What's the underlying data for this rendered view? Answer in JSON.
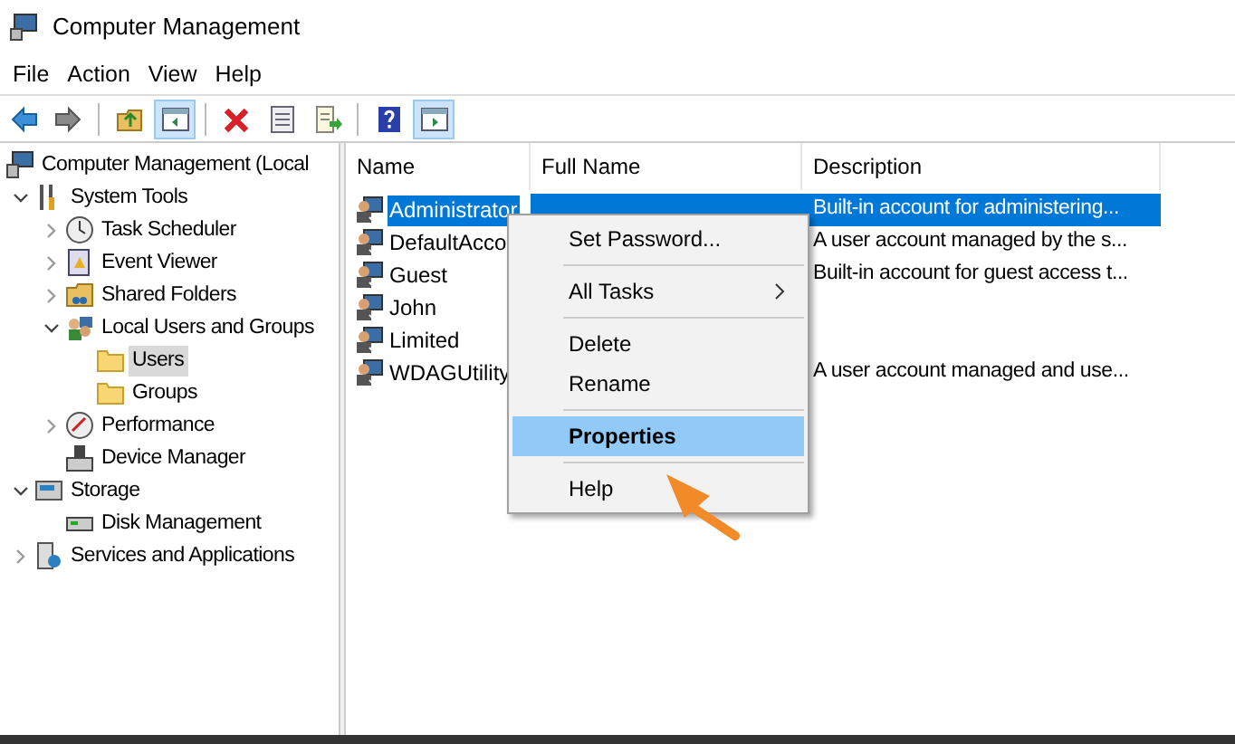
{
  "window": {
    "title": "Computer Management"
  },
  "menu": [
    "File",
    "Action",
    "View",
    "Help"
  ],
  "toolbar": {
    "groups": [
      [
        {
          "pressed": false
        },
        {
          "pressed": false
        }
      ],
      [
        {
          "pressed": false
        },
        {
          "pressed": true
        }
      ],
      [
        {
          "pressed": false
        },
        {
          "pressed": false
        },
        {
          "pressed": false
        }
      ],
      [
        {
          "pressed": false
        },
        {
          "pressed": true
        }
      ]
    ]
  },
  "tree": [
    {
      "label": "Computer Management (Local",
      "kind": "computer",
      "selected": false,
      "children": [
        {
          "label": "System Tools",
          "expandable": true,
          "expanded": true,
          "kind": "tools",
          "selected": false,
          "children": [
            {
              "label": "Task Scheduler",
              "expandable": true,
              "expanded": false,
              "kind": "clock",
              "selected": false
            },
            {
              "label": "Event Viewer",
              "expandable": true,
              "expanded": false,
              "kind": "log",
              "selected": false
            },
            {
              "label": "Shared Folders",
              "expandable": true,
              "expanded": false,
              "kind": "share",
              "selected": false
            },
            {
              "label": "Local Users and Groups",
              "expandable": true,
              "expanded": true,
              "kind": "users",
              "selected": false,
              "children": [
                {
                  "label": "Users",
                  "expandable": false,
                  "kind": "folder",
                  "selected": true
                },
                {
                  "label": "Groups",
                  "expandable": false,
                  "kind": "folder",
                  "selected": false
                }
              ]
            },
            {
              "label": "Performance",
              "expandable": true,
              "expanded": false,
              "kind": "gauge",
              "selected": false
            },
            {
              "label": "Device Manager",
              "expandable": false,
              "kind": "device",
              "selected": false
            }
          ]
        },
        {
          "label": "Storage",
          "expandable": true,
          "expanded": true,
          "kind": "storage",
          "selected": false,
          "children": [
            {
              "label": "Disk Management",
              "expandable": false,
              "kind": "disk",
              "selected": false
            }
          ]
        },
        {
          "label": "Services and Applications",
          "expandable": true,
          "expanded": false,
          "kind": "services",
          "selected": false
        }
      ]
    }
  ],
  "table": {
    "columns": [
      "Name",
      "Full Name",
      "Description"
    ],
    "rows": [
      {
        "name": "Administrator",
        "full_name": "",
        "description": "Built-in account for administering...",
        "selected": true
      },
      {
        "name": "DefaultAcco",
        "full_name": "",
        "description": "A user account managed by the s...",
        "selected": false
      },
      {
        "name": "Guest",
        "full_name": "",
        "description": "Built-in account for guest access t...",
        "selected": false
      },
      {
        "name": "John",
        "full_name": "",
        "description": "",
        "selected": false
      },
      {
        "name": "Limited",
        "full_name": "",
        "description": "",
        "selected": false
      },
      {
        "name": "WDAGUtility",
        "full_name": "",
        "description": "A user account managed and use...",
        "selected": false
      }
    ]
  },
  "context_menu": [
    {
      "label": "Set Password...",
      "submenu": false,
      "separator_after": true,
      "selected": false
    },
    {
      "label": "All Tasks",
      "submenu": true,
      "separator_after": true,
      "selected": false
    },
    {
      "label": "Delete",
      "submenu": false,
      "separator_after": false,
      "selected": false
    },
    {
      "label": "Rename",
      "submenu": false,
      "separator_after": true,
      "selected": false
    },
    {
      "label": "Properties",
      "submenu": false,
      "separator_after": true,
      "selected": true
    },
    {
      "label": "Help",
      "submenu": false,
      "separator_after": false,
      "selected": false
    }
  ]
}
